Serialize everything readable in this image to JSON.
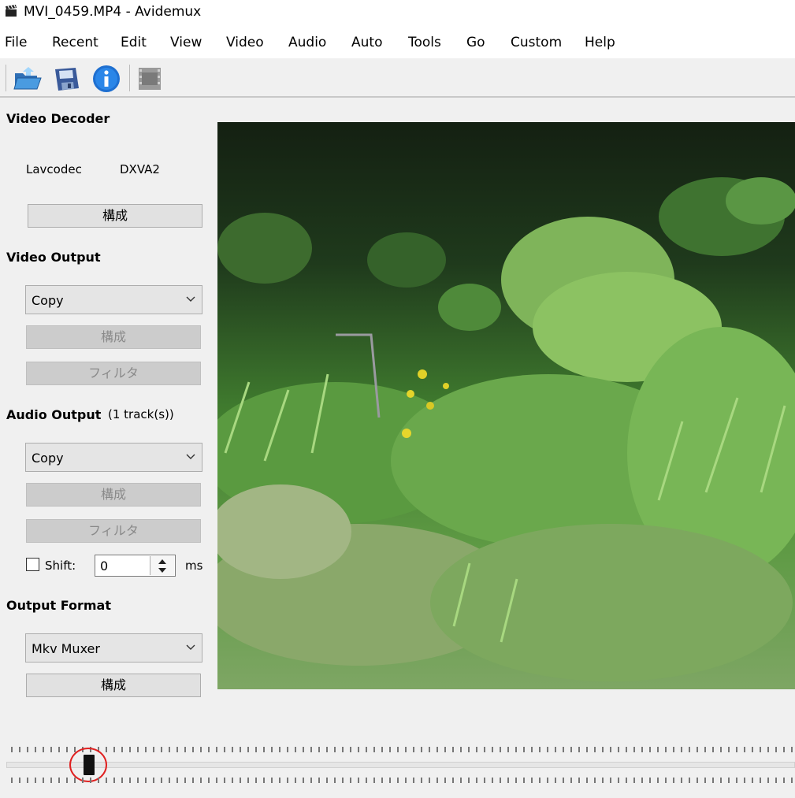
{
  "window": {
    "title": "MVI_0459.MP4 - Avidemux",
    "app_icon": "clapperboard-icon"
  },
  "menu": [
    {
      "label": "File"
    },
    {
      "label": "Recent"
    },
    {
      "label": "Edit"
    },
    {
      "label": "View"
    },
    {
      "label": "Video"
    },
    {
      "label": "Audio"
    },
    {
      "label": "Auto"
    },
    {
      "label": "Tools"
    },
    {
      "label": "Go"
    },
    {
      "label": "Custom"
    },
    {
      "label": "Help"
    }
  ],
  "toolbar": {
    "buttons": [
      {
        "icon": "open-folder-icon"
      },
      {
        "icon": "save-disk-icon"
      },
      {
        "icon": "info-icon"
      },
      {
        "icon": "film-properties-icon",
        "enabled": false
      }
    ]
  },
  "video_decoder": {
    "heading": "Video Decoder",
    "codec": "Lavcodec",
    "hw": "DXVA2",
    "configure_label": "構成"
  },
  "video_output": {
    "heading": "Video Output",
    "selected": "Copy",
    "configure_label": "構成",
    "filters_label": "フィルタ"
  },
  "audio_output": {
    "heading": "Audio Output",
    "tracks": "(1 track(s))",
    "selected": "Copy",
    "configure_label": "構成",
    "filters_label": "フィルタ",
    "shift_label": "Shift:",
    "shift_checked": false,
    "shift_value": "0",
    "shift_unit": "ms"
  },
  "output_format": {
    "heading": "Output Format",
    "selected": "Mkv Muxer",
    "configure_label": "構成"
  },
  "video_preview": {
    "content": "video-frame-vegetation"
  },
  "timeline": {
    "position_fraction": 0.1,
    "highlight_color": "#e02020"
  }
}
